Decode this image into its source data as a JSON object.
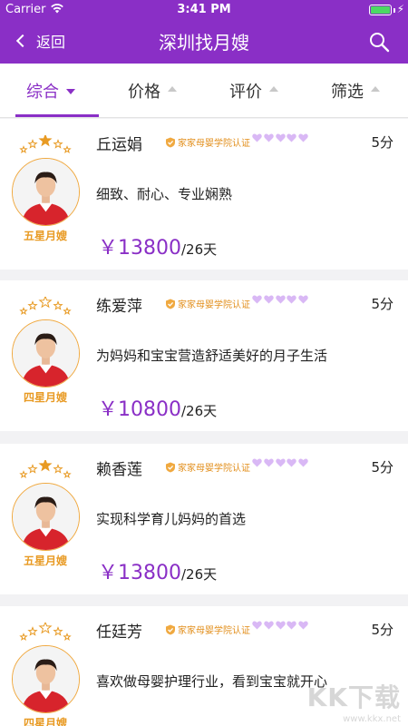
{
  "status_bar": {
    "carrier": "Carrier",
    "time": "3:41 PM"
  },
  "nav": {
    "back_label": "返回",
    "title": "深圳找月嫂"
  },
  "filters": [
    {
      "label": "综合",
      "active": true
    },
    {
      "label": "价格",
      "active": false
    },
    {
      "label": "评价",
      "active": false
    },
    {
      "label": "筛选",
      "active": false
    }
  ],
  "colors": {
    "brand": "#8a2fc6",
    "gold": "#e89a23",
    "heart": "#d9b8f5"
  },
  "nannies": [
    {
      "name": "丘运娟",
      "cert": "家家母婴学院认证",
      "score": "5分",
      "level": "五星月嫂",
      "stars_lit": 1,
      "desc": "细致、耐心、专业娴熟",
      "price": "￥13800",
      "unit": "/26天"
    },
    {
      "name": "练爱萍",
      "cert": "家家母婴学院认证",
      "score": "5分",
      "level": "四星月嫂",
      "stars_lit": 0,
      "desc": "为妈妈和宝宝营造舒适美好的月子生活",
      "price": "￥10800",
      "unit": "/26天"
    },
    {
      "name": "赖香莲",
      "cert": "家家母婴学院认证",
      "score": "5分",
      "level": "五星月嫂",
      "stars_lit": 1,
      "desc": "实现科学育儿妈妈的首选",
      "price": "￥13800",
      "unit": "/26天"
    },
    {
      "name": "任廷芳",
      "cert": "家家母婴学院认证",
      "score": "5分",
      "level": "四星月嫂",
      "stars_lit": 0,
      "desc": "喜欢做母婴护理行业，看到宝宝就开心",
      "price": "",
      "unit": ""
    }
  ],
  "watermark": {
    "main": "KK下载",
    "sub": "www.kkx.net"
  }
}
